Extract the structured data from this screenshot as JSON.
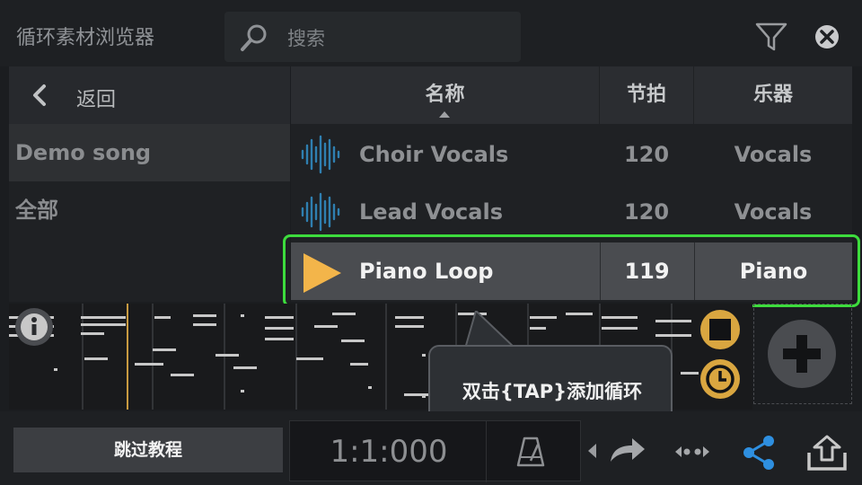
{
  "header": {
    "title": "循环素材浏览器",
    "search_placeholder": "搜索"
  },
  "sidebar": {
    "back_label": "返回",
    "items": [
      {
        "label": "Demo song",
        "selected": true
      },
      {
        "label": "全部",
        "selected": false
      }
    ]
  },
  "table": {
    "columns": [
      "名称",
      "节拍",
      "乐器"
    ],
    "sort_column": "名称",
    "rows": [
      {
        "name": "Choir Vocals",
        "bpm": "120",
        "instrument": "Vocals",
        "icon": "waveform-icon",
        "selected": false
      },
      {
        "name": "Lead Vocals",
        "bpm": "120",
        "instrument": "Vocals",
        "icon": "waveform-icon",
        "selected": false
      },
      {
        "name": "Piano Loop",
        "bpm": "119",
        "instrument": "Piano",
        "icon": "play-icon",
        "selected": true
      }
    ]
  },
  "tooltip": {
    "text": "双击{TAP}添加循环"
  },
  "bottom": {
    "skip_label": "跳过教程",
    "position": "1:1:000"
  },
  "colors": {
    "highlight": "#3ddc3d",
    "play_icon": "#f3b54a",
    "waveform": "#2f7fb0",
    "share": "#2e8fe0",
    "transport_accent": "#d9a640"
  },
  "icons": [
    "search-icon",
    "filter-icon",
    "close-icon",
    "chevron-left-icon",
    "info-icon",
    "stop-icon",
    "clock-icon",
    "add-icon",
    "metronome-icon",
    "redo-icon",
    "loop-icon",
    "share-icon",
    "export-icon"
  ]
}
